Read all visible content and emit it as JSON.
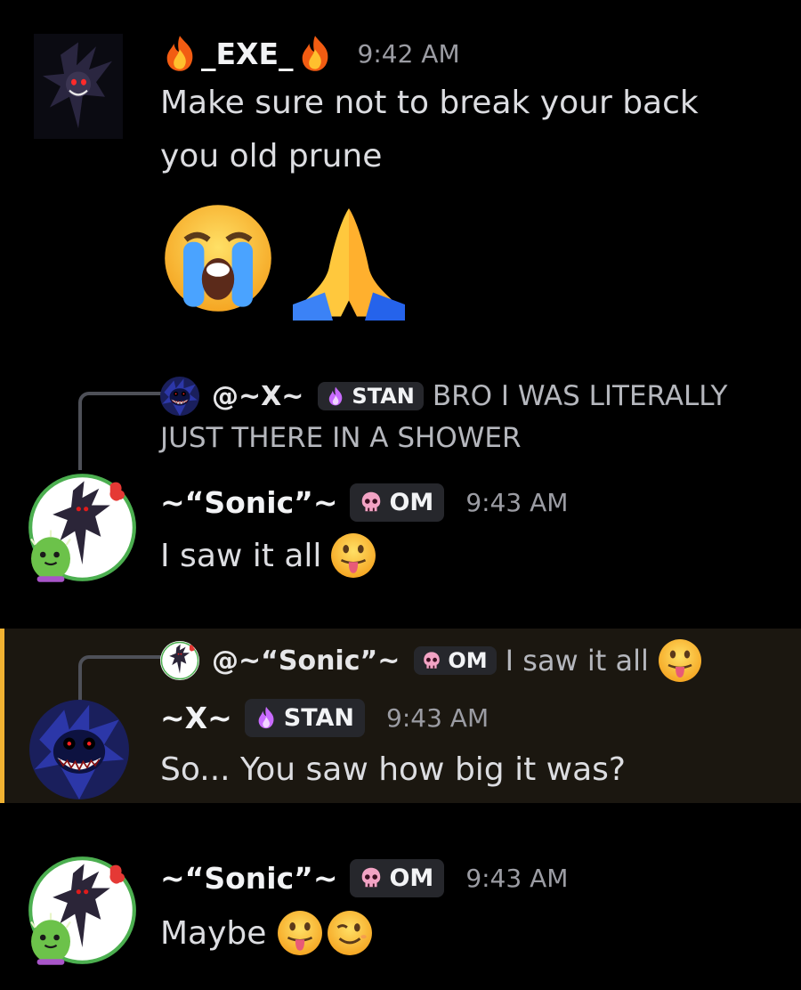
{
  "messages": [
    {
      "author": "_EXE_",
      "author_prefix_emoji": "fire-icon",
      "author_suffix_emoji": "fire-icon",
      "time": "9:42 AM",
      "lines": [
        "Make sure not to break your back",
        "you old prune"
      ],
      "big_emojis": [
        "loudly-crying-face-icon",
        "folded-hands-icon"
      ]
    },
    {
      "reply": {
        "author": "@~X~",
        "tag": "STAN",
        "text_line1": "BRO I WAS LITERALLY",
        "text_line2": "JUST THERE IN A SHOWER"
      },
      "author": "~“Sonic”~",
      "tag": "OM",
      "time": "9:43 AM",
      "text": "I saw it all",
      "emojis": [
        "tongue-out-face-icon"
      ]
    },
    {
      "highlighted": true,
      "reply": {
        "author": "@~“Sonic”~",
        "tag": "OM",
        "text": "I saw it all"
      },
      "author": "~X~",
      "tag": "STAN",
      "time": "9:43 AM",
      "text": "So... You saw how big it was?"
    },
    {
      "author": "~“Sonic”~",
      "tag": "OM",
      "time": "9:43 AM",
      "text": "Maybe",
      "emojis": [
        "tongue-out-face-icon",
        "winking-face-icon"
      ]
    }
  ],
  "colors": {
    "background": "#000000",
    "highlight_bg": "#1b1710",
    "highlight_bar": "#f0b232",
    "tag_bg": "#26272c",
    "timestamp": "#9b9ca3"
  }
}
